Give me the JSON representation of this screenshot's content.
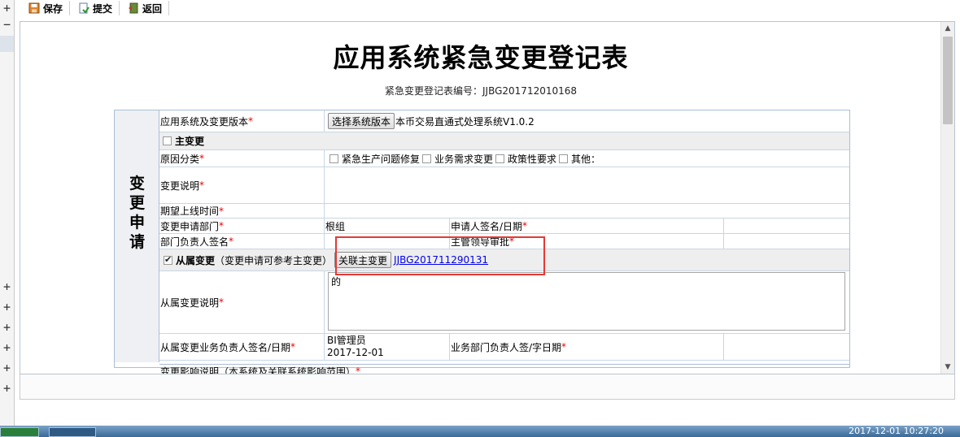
{
  "toolbar": {
    "save": "保存",
    "submit": "提交",
    "back": "返回"
  },
  "gutter": {
    "plus": "+",
    "minus": "−"
  },
  "page": {
    "title": "应用系统紧急变更登记表",
    "form_no_label": "紧急变更登记表编号：",
    "form_no": "JJBG201712010168"
  },
  "section": {
    "label": "变更申请",
    "chars": [
      "变",
      "更",
      "申",
      "请"
    ]
  },
  "fields": {
    "app_version_label": "应用系统及变更版本",
    "select_version_btn": "选择系统版本",
    "app_version_value": "本币交易直通式处理系统V1.0.2",
    "main_change_label": "主变更",
    "reason_label": "原因分类",
    "reason_options": [
      "紧急生产问题修复",
      "业务需求变更",
      "政策性要求",
      "其他："
    ],
    "change_desc_label": "变更说明",
    "expected_online_label": "期望上线时间",
    "dept_label": "变更申请部门",
    "dept_value": "根组",
    "applicant_sign_label": "申请人签名/日期",
    "dept_head_sign_label": "部门负责人签名",
    "leader_approval_label": "主管领导审批",
    "sub_change_label": "从属变更",
    "sub_change_hint": "（变更申请可参考主变更）",
    "link_main_btn": "关联主变更",
    "linked_change_no": "JJBG201711290131",
    "sub_change_desc_label": "从属变更说明",
    "sub_change_desc_value": "的",
    "sub_owner_sign_label": "从属变更业务负责人签名/日期",
    "sub_owner_name": "BI管理员",
    "sub_owner_date": "2017-12-01",
    "biz_dept_head_sign_label": "业务部门负责人签/字日期",
    "impact_label": "变更影响说明（本系统及关联系统影响范围）",
    "required_mark": "*"
  },
  "taskbar": {
    "clock": "2017-12-01  10:27:20"
  },
  "colors": {
    "required": "#e00000",
    "highlight_box": "#e53935",
    "link": "#0000ee",
    "border": "#a9bfd6"
  },
  "icons": {
    "save": "floppy-icon",
    "submit": "submit-doc-icon",
    "back": "return-icon"
  }
}
